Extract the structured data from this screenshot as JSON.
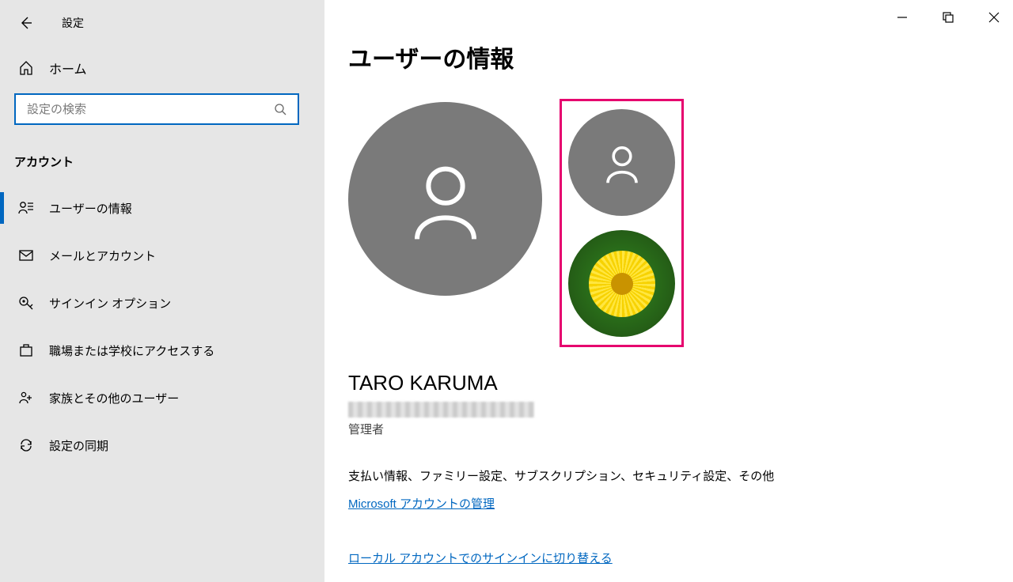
{
  "app": {
    "title": "設定"
  },
  "home": {
    "label": "ホーム"
  },
  "search": {
    "placeholder": "設定の検索"
  },
  "section": {
    "title": "アカウント"
  },
  "nav": [
    {
      "key": "user-info",
      "label": "ユーザーの情報",
      "active": true
    },
    {
      "key": "mail-acct",
      "label": "メールとアカウント",
      "active": false
    },
    {
      "key": "signin-opt",
      "label": "サインイン オプション",
      "active": false
    },
    {
      "key": "work-school",
      "label": "職場または学校にアクセスする",
      "active": false
    },
    {
      "key": "family",
      "label": "家族とその他のユーザー",
      "active": false
    },
    {
      "key": "sync",
      "label": "設定の同期",
      "active": false
    }
  ],
  "page": {
    "title": "ユーザーの情報",
    "user_name": "TARO KARUMA",
    "user_role": "管理者",
    "desc": "支払い情報、ファミリー設定、サブスクリプション、セキュリティ設定、その他",
    "link_manage": "Microsoft アカウントの管理",
    "link_local": "ローカル アカウントでのサインインに切り替える"
  }
}
